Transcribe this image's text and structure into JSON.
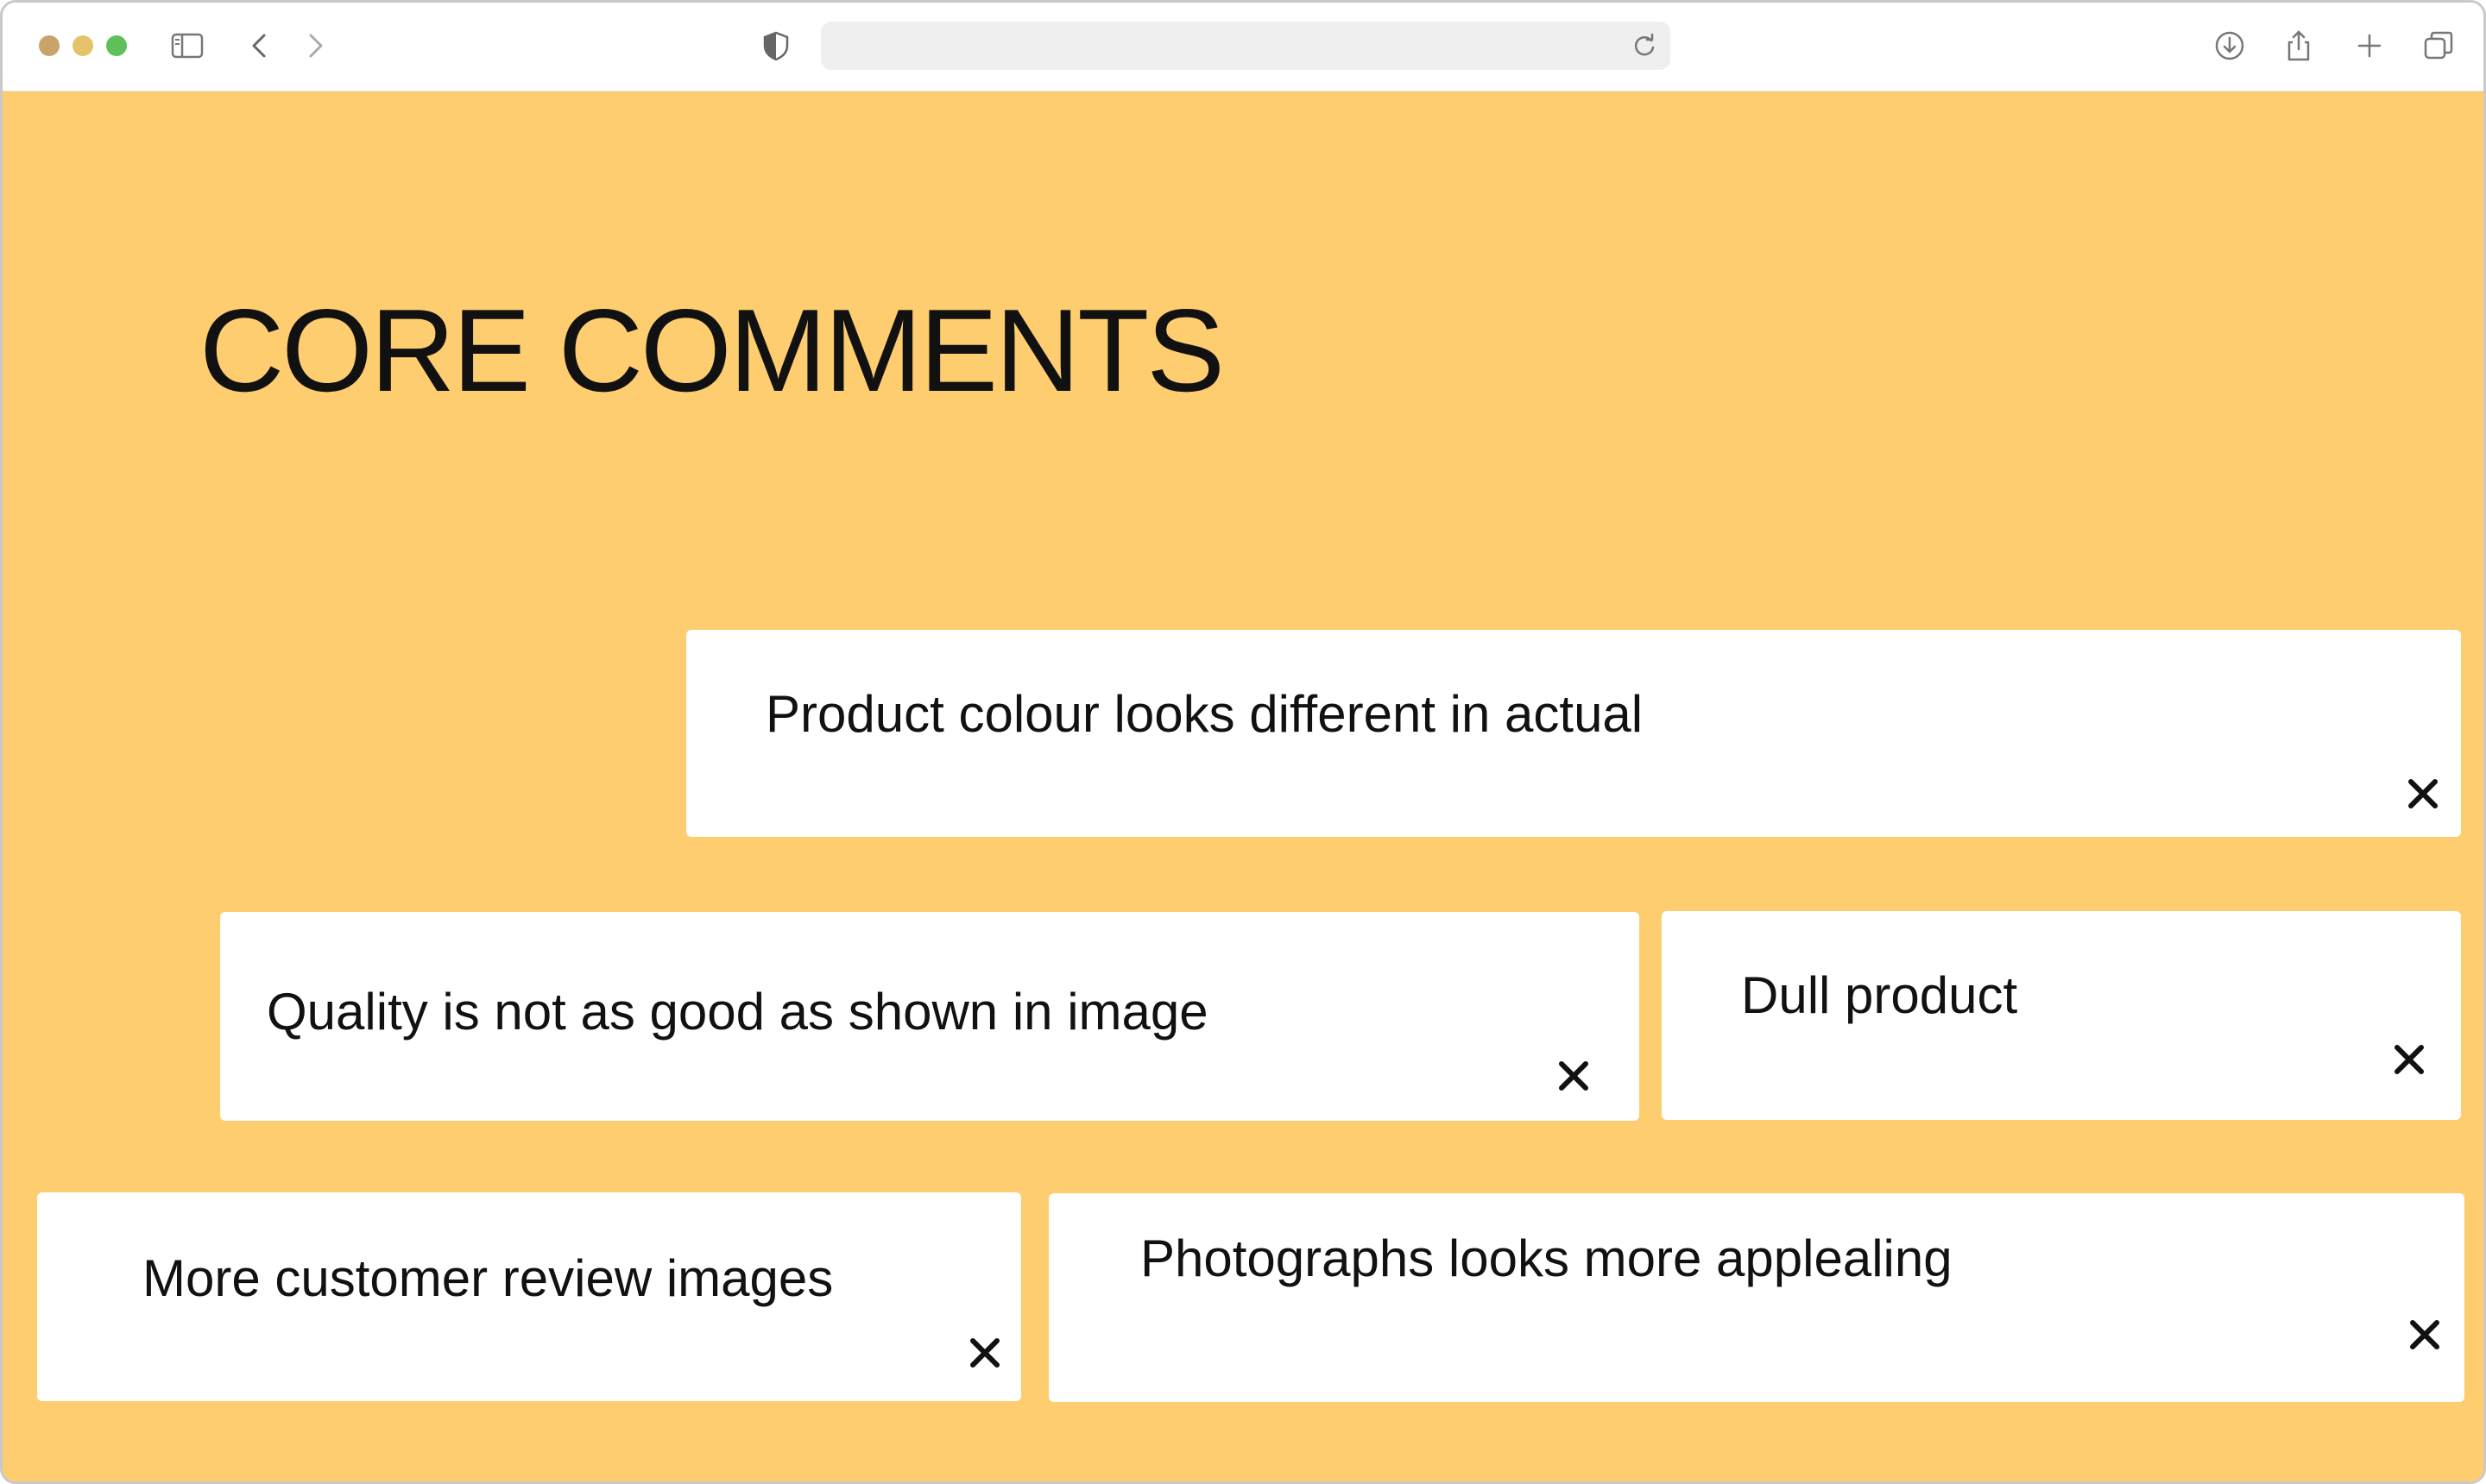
{
  "browser": {
    "traffic_colors": {
      "close": "#C9A36A",
      "minimize": "#E6C36A",
      "zoom": "#5FBF58"
    },
    "address": {
      "value": "",
      "placeholder": ""
    },
    "icons": [
      "sidebar-icon",
      "back-icon",
      "forward-icon",
      "privacy-shield-icon",
      "reload-icon",
      "download-icon",
      "share-icon",
      "new-tab-icon",
      "tab-overview-icon"
    ]
  },
  "page": {
    "background": "#FDCD6F",
    "title": "CORE COMMENTS",
    "comments": [
      {
        "text": "Product colour looks different in actual"
      },
      {
        "text": "Quality is not as good as shown in image"
      },
      {
        "text": "Dull product"
      },
      {
        "text": "More customer review images"
      },
      {
        "text": "Photographs looks more applealing"
      }
    ]
  }
}
